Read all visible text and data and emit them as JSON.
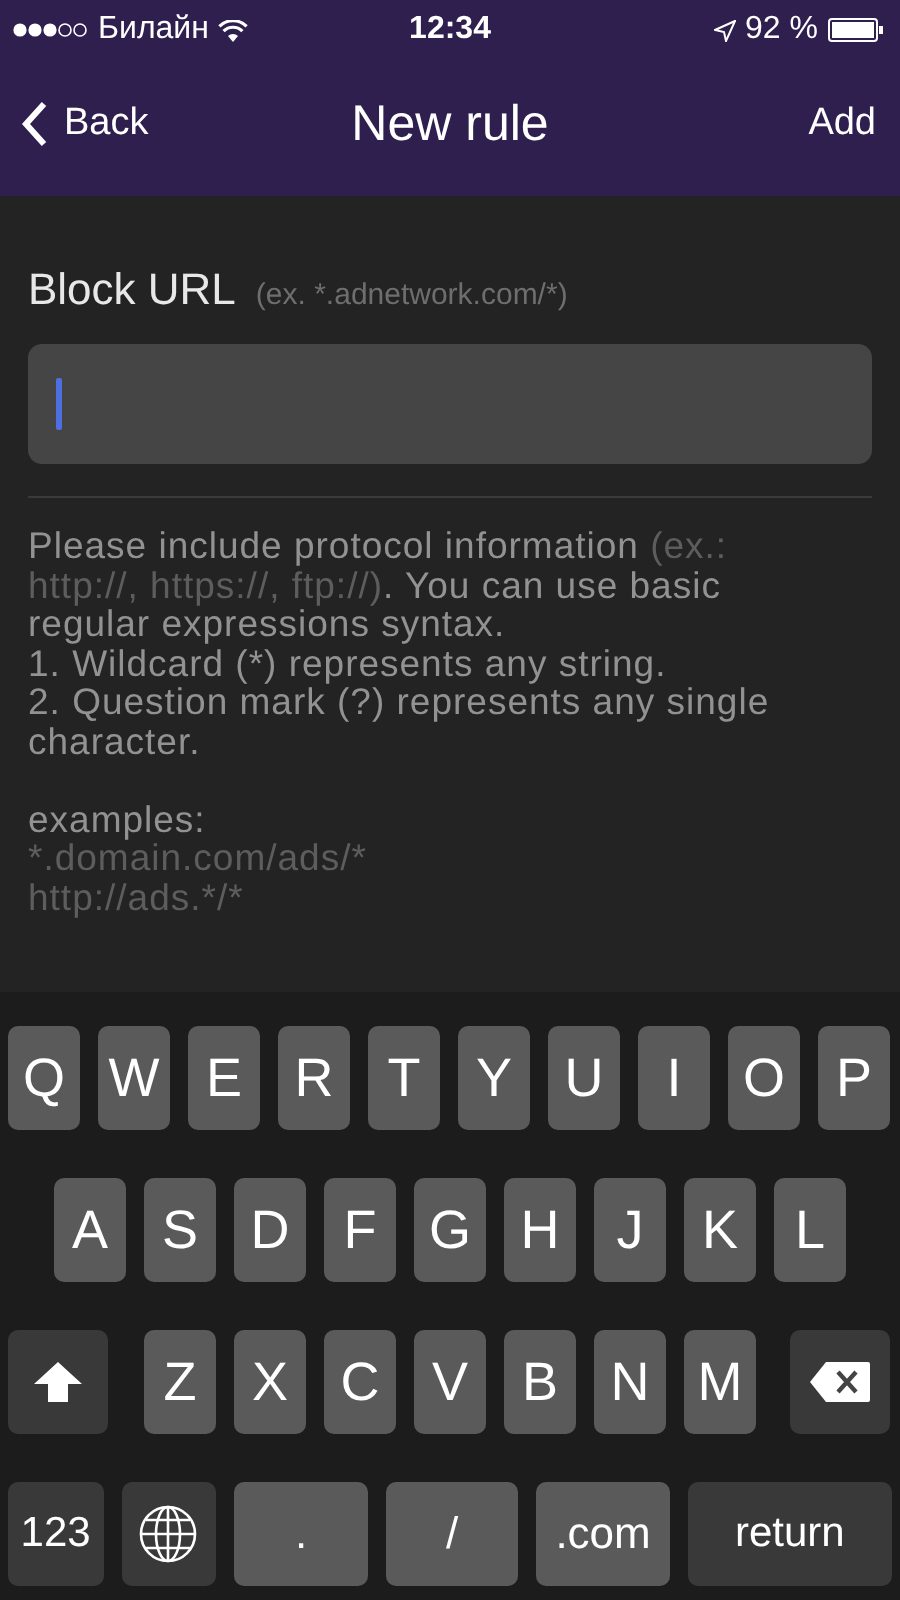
{
  "status_bar": {
    "carrier": "Билайн",
    "time": "12:34",
    "battery": "92 %"
  },
  "nav": {
    "back": "Back",
    "title": "New rule",
    "action": "Add"
  },
  "field": {
    "label": "Block URL",
    "hint": "(ex. *.adnetwork.com/*)"
  },
  "help": {
    "segments": [
      {
        "text": "Please include protocol information ",
        "kind": "normal"
      },
      {
        "text": "(ex.: http://, https://, ftp://)",
        "kind": "hint"
      },
      {
        "text": ". You can use basic regular expressions syntax.",
        "kind": "normal"
      }
    ],
    "rules": [
      "1. Wildcard (*) represents any string.",
      "2. Question mark (?) represents any single character."
    ],
    "examples_label": "examples:",
    "examples": [
      "*.domain.com/ads/*",
      "http://ads.*/*"
    ]
  },
  "keyboard": {
    "rows": [
      {
        "keys": [
          {
            "kind": "letter",
            "label": "Q"
          },
          {
            "kind": "letter",
            "label": "W"
          },
          {
            "kind": "letter",
            "label": "E"
          },
          {
            "kind": "letter",
            "label": "R"
          },
          {
            "kind": "letter",
            "label": "T"
          },
          {
            "kind": "letter",
            "label": "Y"
          },
          {
            "kind": "letter",
            "label": "U"
          },
          {
            "kind": "letter",
            "label": "I"
          },
          {
            "kind": "letter",
            "label": "O"
          },
          {
            "kind": "letter",
            "label": "P"
          }
        ]
      },
      {
        "keys": [
          {
            "kind": "letter",
            "label": "A"
          },
          {
            "kind": "letter",
            "label": "S"
          },
          {
            "kind": "letter",
            "label": "D"
          },
          {
            "kind": "letter",
            "label": "F"
          },
          {
            "kind": "letter",
            "label": "G"
          },
          {
            "kind": "letter",
            "label": "H"
          },
          {
            "kind": "letter",
            "label": "J"
          },
          {
            "kind": "letter",
            "label": "K"
          },
          {
            "kind": "letter",
            "label": "L"
          }
        ]
      },
      {
        "keys": [
          {
            "kind": "shift"
          },
          {
            "kind": "letter",
            "label": "Z"
          },
          {
            "kind": "letter",
            "label": "X"
          },
          {
            "kind": "letter",
            "label": "C"
          },
          {
            "kind": "letter",
            "label": "V"
          },
          {
            "kind": "letter",
            "label": "B"
          },
          {
            "kind": "letter",
            "label": "N"
          },
          {
            "kind": "letter",
            "label": "M"
          },
          {
            "kind": "delete"
          }
        ]
      },
      {
        "keys": [
          {
            "kind": "mode",
            "label": "123"
          },
          {
            "kind": "globe"
          },
          {
            "kind": "wide",
            "label": "."
          },
          {
            "kind": "wide",
            "label": "/"
          },
          {
            "kind": "wide",
            "label": ".com"
          },
          {
            "kind": "return",
            "label": "return"
          }
        ]
      }
    ]
  }
}
